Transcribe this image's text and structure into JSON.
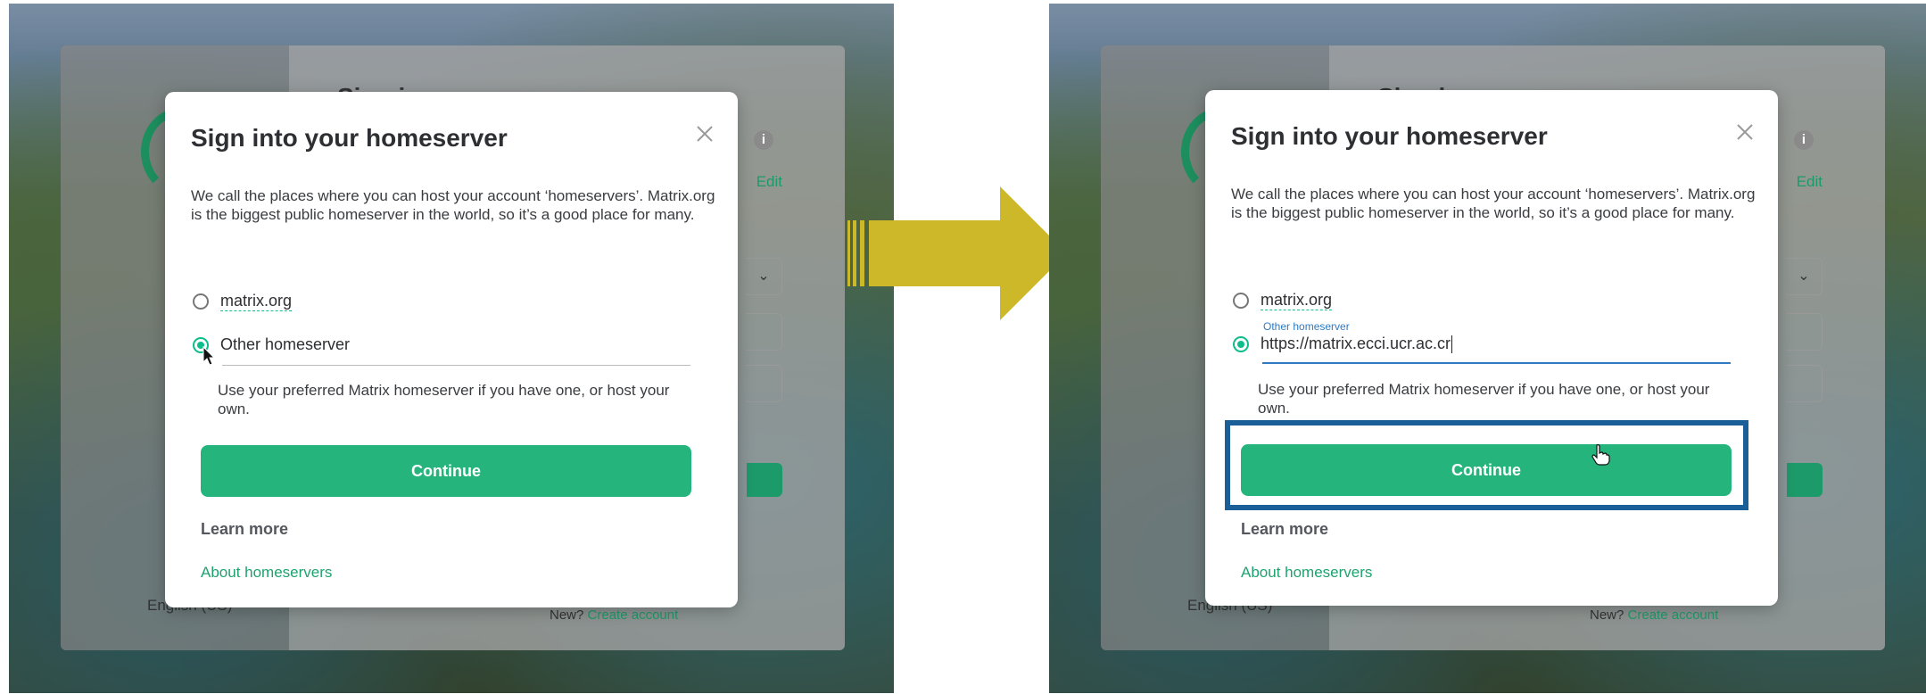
{
  "left": {
    "modal": {
      "title": "Sign into your homeserver",
      "description": "We call the places where you can host your account ‘homeservers’. Matrix.org is the biggest public homeserver in the world, so it’s a good place for many.",
      "option_matrix": "matrix.org",
      "option_other": "Other homeserver",
      "selected": "Other homeserver",
      "hint": "Use your preferred Matrix homeserver if you have one, or host your own.",
      "continue_label": "Continue",
      "learn_more": "Learn more",
      "about_link": "About homeservers"
    },
    "background": {
      "title_fragment": "Sign i",
      "edit_link": "Edit",
      "language": "English (US)",
      "new_label": "New?",
      "create_account": "Create account"
    }
  },
  "right": {
    "modal": {
      "title": "Sign into your homeserver",
      "description": "We call the places where you can host your account ‘homeservers’. Matrix.org is the biggest public homeserver in the world, so it’s a good place for many.",
      "option_matrix": "matrix.org",
      "field_label": "Other homeserver",
      "field_value": "https://matrix.ecci.ucr.ac.cr",
      "selected": "Other homeserver",
      "hint": "Use your preferred Matrix homeserver if you have one, or host your own.",
      "continue_label": "Continue",
      "learn_more": "Learn more",
      "about_link": "About homeservers"
    },
    "background": {
      "title_fragment": "Sign i",
      "edit_link": "Edit",
      "language": "English (US)",
      "new_label": "New?",
      "create_account": "Create account"
    }
  },
  "colors": {
    "accent_green": "#26b47d",
    "link_green": "#1ea36f",
    "highlight_blue": "#1b5f98",
    "arrow_yellow": "#cdb82a",
    "field_blue": "#2f7ac3"
  },
  "icons": [
    "close-icon",
    "info-icon",
    "chevron-down-icon",
    "pointer-cursor-icon",
    "hand-cursor-icon",
    "right-arrow-icon"
  ]
}
